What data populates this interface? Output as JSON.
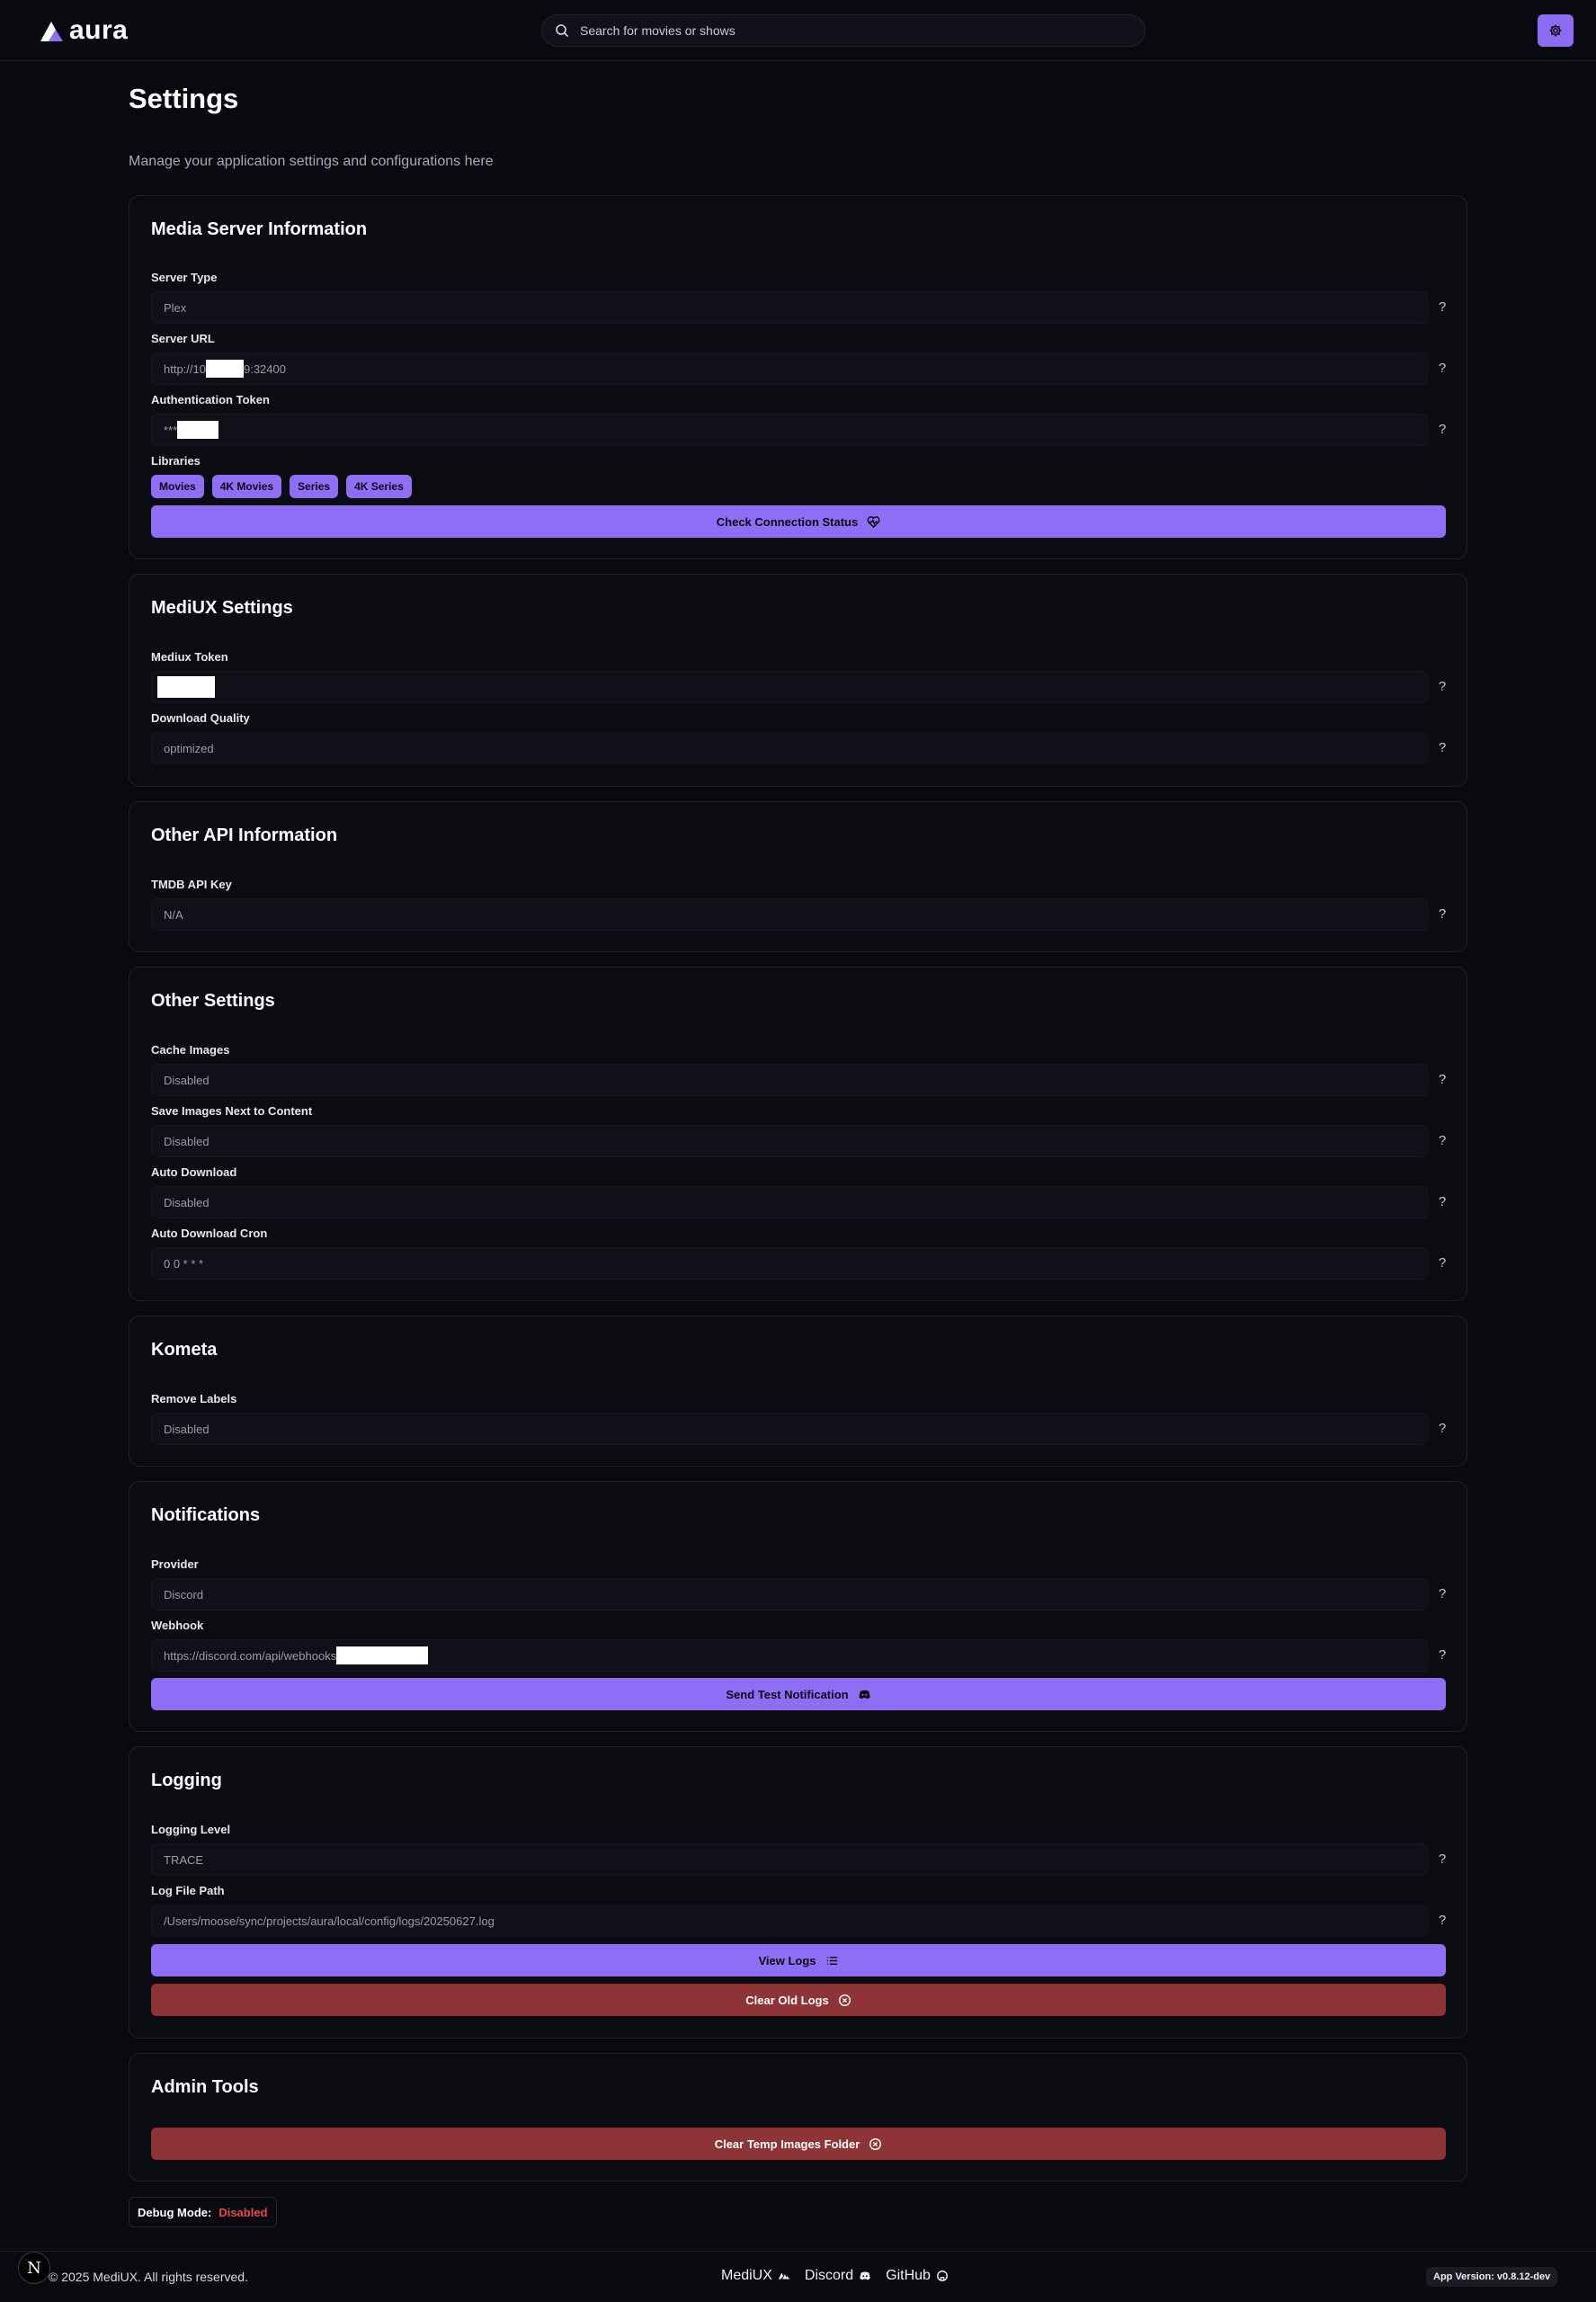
{
  "app": {
    "name": "aura",
    "search_placeholder": "Search for movies or shows"
  },
  "page": {
    "title": "Settings",
    "subtitle": "Manage your application settings and configurations here"
  },
  "media_server": {
    "title": "Media Server Information",
    "server_type_label": "Server Type",
    "server_type_value": "Plex",
    "server_url_label": "Server URL",
    "server_url_prefix": "http://10",
    "server_url_suffix": "9:32400",
    "auth_token_label": "Authentication Token",
    "auth_token_prefix": "***",
    "libraries_label": "Libraries",
    "libraries": [
      "Movies",
      "4K Movies",
      "Series",
      "4K Series"
    ],
    "check_button": "Check Connection Status"
  },
  "mediux": {
    "title": "MediUX Settings",
    "token_label": "Mediux Token",
    "quality_label": "Download Quality",
    "quality_value": "optimized"
  },
  "other_api": {
    "title": "Other API Information",
    "tmdb_label": "TMDB API Key",
    "tmdb_value": "N/A"
  },
  "other_settings": {
    "title": "Other Settings",
    "cache_label": "Cache Images",
    "cache_value": "Disabled",
    "save_next_label": "Save Images Next to Content",
    "save_next_value": "Disabled",
    "auto_download_label": "Auto Download",
    "auto_download_value": "Disabled",
    "cron_label": "Auto Download Cron",
    "cron_value": "0 0 * * *"
  },
  "kometa": {
    "title": "Kometa",
    "remove_labels_label": "Remove Labels",
    "remove_labels_value": "Disabled"
  },
  "notifications": {
    "title": "Notifications",
    "provider_label": "Provider",
    "provider_value": "Discord",
    "webhook_label": "Webhook",
    "webhook_prefix": "https://discord.com/api/webhooks",
    "test_button": "Send Test Notification"
  },
  "logging": {
    "title": "Logging",
    "level_label": "Logging Level",
    "level_value": "TRACE",
    "path_label": "Log File Path",
    "path_value": "/Users/moose/sync/projects/aura/local/config/logs/20250627.log",
    "view_button": "View Logs",
    "clear_button": "Clear Old Logs"
  },
  "admin": {
    "title": "Admin Tools",
    "clear_temp_button": "Clear Temp Images Folder"
  },
  "debug": {
    "label": "Debug Mode:",
    "value": "Disabled"
  },
  "footer": {
    "copyright": "© 2025 MediUX. All rights reserved.",
    "links": [
      "MediUX",
      "Discord",
      "GitHub"
    ],
    "version": "App Version: v0.8.12-dev",
    "next_badge": "N"
  },
  "colors": {
    "accent": "#8d6ef5",
    "danger": "#8e3436",
    "background": "#090a10",
    "disabled_text": "#e5484d"
  },
  "icons": {
    "search": "search-icon",
    "settings": "gear-icon",
    "connection": "heart-pulse-icon",
    "discord": "discord-icon",
    "logs": "list-icon",
    "clear": "circle-x-icon",
    "github": "github-icon"
  }
}
